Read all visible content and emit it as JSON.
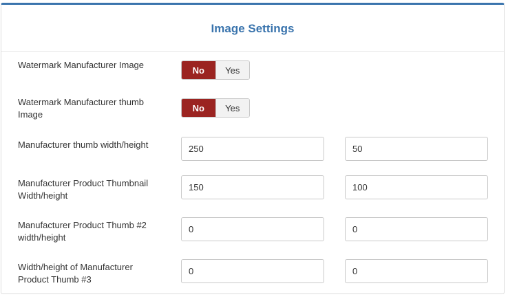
{
  "header": {
    "title": "Image Settings"
  },
  "rows": [
    {
      "label": "Watermark Manufacturer Image",
      "type": "toggle",
      "no": "No",
      "yes": "Yes",
      "selected": "No"
    },
    {
      "label": "Watermark Manufacturer thumb Image",
      "type": "toggle",
      "no": "No",
      "yes": "Yes",
      "selected": "No"
    },
    {
      "label": "Manufacturer thumb width/height",
      "type": "pair",
      "v1": "250",
      "v2": "50"
    },
    {
      "label": "Manufacturer Product Thumbnail Width/height",
      "type": "pair",
      "v1": "150",
      "v2": "100"
    },
    {
      "label": "Manufacturer Product Thumb #2 width/height",
      "type": "pair",
      "v1": "0",
      "v2": "0"
    },
    {
      "label": "Width/height of Manufacturer Product Thumb #3",
      "type": "pair",
      "v1": "0",
      "v2": "0"
    }
  ],
  "colors": {
    "accent": "#3a74ad",
    "toggle_active": "#9b2421"
  }
}
